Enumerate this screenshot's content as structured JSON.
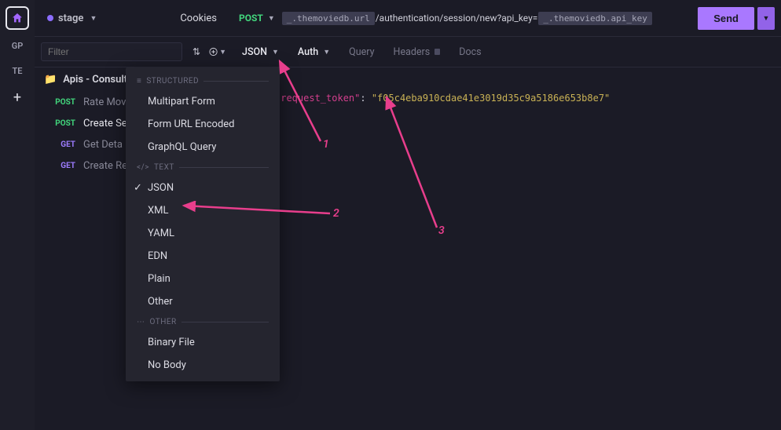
{
  "leftbar": {
    "home_icon": "home-icon",
    "workspaces": [
      "GP",
      "TE"
    ],
    "add_label": "+"
  },
  "sidebar": {
    "env": "stage",
    "cookies_label": "Cookies",
    "filter_placeholder": "Filter",
    "folder_label": "Apis - Consulta",
    "requests": [
      {
        "method": "POST",
        "name": "Rate Mov",
        "active": false,
        "mclass": "m-post"
      },
      {
        "method": "POST",
        "name": "Create Se",
        "active": true,
        "mclass": "m-post"
      },
      {
        "method": "GET",
        "name": "Get Deta",
        "active": false,
        "mclass": "m-get"
      },
      {
        "method": "GET",
        "name": "Create Re",
        "active": false,
        "mclass": "m-get"
      }
    ]
  },
  "main": {
    "method": "POST",
    "url_var1": "_.themoviedb.url",
    "url_path": "/authentication/session/new?api_key=",
    "url_var2": "_.themoviedb.api_key",
    "send_label": "Send",
    "tabs": {
      "json": "JSON",
      "auth": "Auth",
      "query": "Query",
      "headers": "Headers",
      "docs": "Docs"
    },
    "body": {
      "key": "\"request_token\"",
      "value": "\"f05c4eba910cdae41e3019d35c9a5186e653b8e7\""
    }
  },
  "dropdown": {
    "structured_label": "STRUCTURED",
    "text_label": "TEXT",
    "other_label": "OTHER",
    "items_structured": [
      "Multipart Form",
      "Form URL Encoded",
      "GraphQL Query"
    ],
    "items_text": [
      "JSON",
      "XML",
      "YAML",
      "EDN",
      "Plain",
      "Other"
    ],
    "items_other": [
      "Binary File",
      "No Body"
    ],
    "checked": "JSON"
  },
  "annotations": {
    "l1": "1",
    "l2": "2",
    "l3": "3"
  }
}
